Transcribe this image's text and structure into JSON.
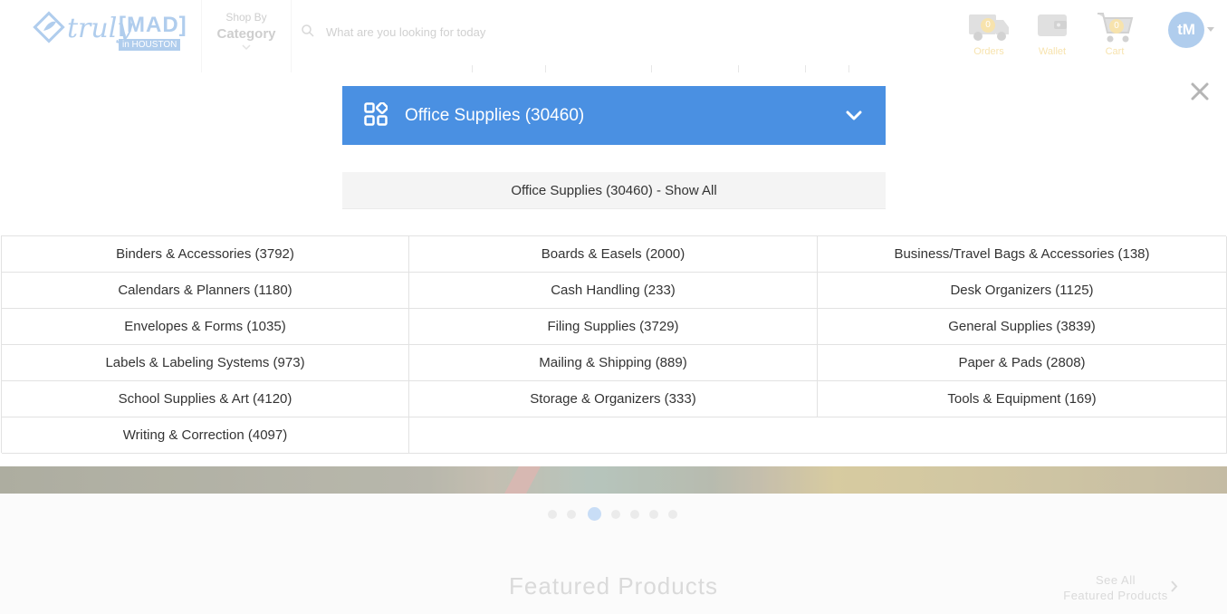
{
  "header": {
    "logo": {
      "script": "truly",
      "mad": "[MAD]",
      "city": "in HOUSTON"
    },
    "shop_by": {
      "line1": "Shop By",
      "line2": "Category"
    },
    "search": {
      "placeholder": "What are you looking for today"
    },
    "orders": {
      "label": "Orders",
      "count": "0"
    },
    "wallet": {
      "label": "Wallet"
    },
    "cart": {
      "label": "Cart",
      "count": "0"
    },
    "avatar": {
      "initials": "tM"
    }
  },
  "category_modal": {
    "title": "Office Supplies (30460)",
    "show_all": "Office Supplies (30460) - Show All",
    "subcategories": [
      "Binders & Accessories (3792)",
      "Boards & Easels (2000)",
      "Business/Travel Bags & Accessories (138)",
      "Calendars & Planners (1180)",
      "Cash Handling (233)",
      "Desk Organizers (1125)",
      "Envelopes & Forms (1035)",
      "Filing Supplies (3729)",
      "General Supplies (3839)",
      "Labels & Labeling Systems (973)",
      "Mailing & Shipping (889)",
      "Paper & Pads (2808)",
      "School Supplies & Art (4120)",
      "Storage & Organizers (333)",
      "Tools & Equipment (169)",
      "Writing & Correction (4097)"
    ]
  },
  "carousel": {
    "dot_count": 7,
    "active_index": 2
  },
  "featured": {
    "title": "Featured Products",
    "see_all_line1": "See All",
    "see_all_line2": "Featured Products"
  },
  "colors": {
    "accent_blue": "#4a90e2",
    "close_gray": "#b5b5b5",
    "gold": "#f6dd9c"
  },
  "icons": {
    "category": "grid-icon",
    "dropdown": "chevron-down-icon",
    "close": "close-icon"
  }
}
